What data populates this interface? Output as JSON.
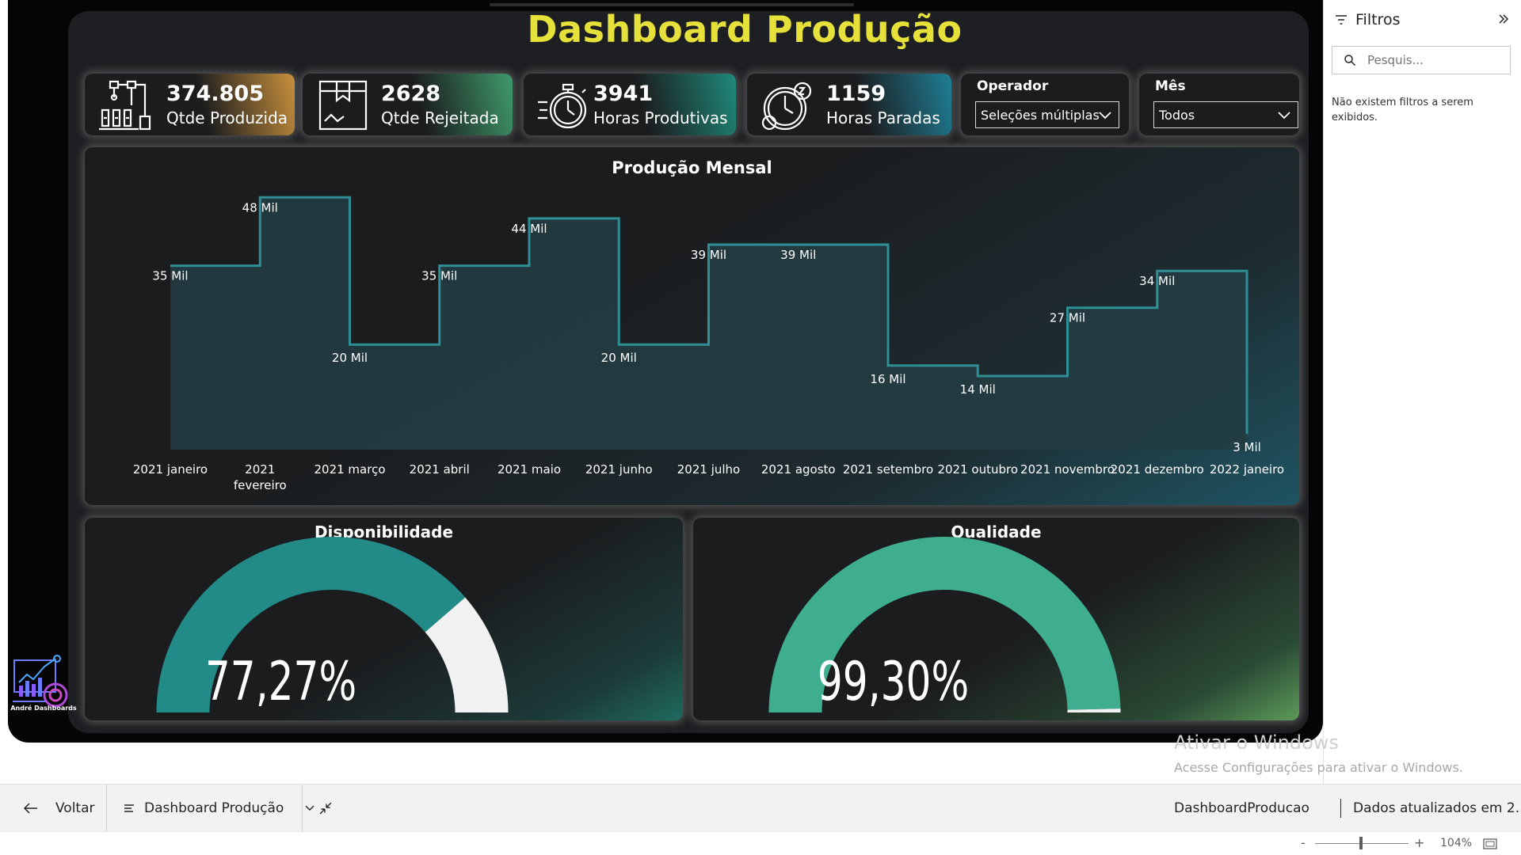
{
  "title": "Dashboard Produção",
  "kpis": [
    {
      "value": "374.805",
      "label": "Qtde Produzida",
      "icon": "robot-arm-factory-icon",
      "accent": "#e0a040"
    },
    {
      "value": "2628",
      "label": "Qtde Rejeitada",
      "icon": "rejected-box-icon",
      "accent": "#4fb07a"
    },
    {
      "value": "3941",
      "label": "Horas Produtivas",
      "icon": "stopwatch-icon",
      "accent": "#2aa08a"
    },
    {
      "value": "1159",
      "label": "Horas Paradas",
      "icon": "clock-sleep-icon",
      "accent": "#2a8aa0"
    }
  ],
  "slicers": {
    "operador": {
      "title": "Operador",
      "value": "Seleções múltiplas"
    },
    "mes": {
      "title": "Mês",
      "value": "Todos"
    }
  },
  "chart_data": {
    "type": "area",
    "title": "Produção Mensal",
    "step": true,
    "categories": [
      "2021 janeiro",
      "2021 fevereiro",
      "2021 março",
      "2021 abril",
      "2021 maio",
      "2021 junho",
      "2021 julho",
      "2021 agosto",
      "2021 setembro",
      "2021 outubro",
      "2021 novembro",
      "2021 dezembro",
      "2022 janeiro"
    ],
    "values": [
      35,
      48,
      20,
      35,
      44,
      20,
      39,
      39,
      16,
      14,
      27,
      34,
      3
    ],
    "data_labels": [
      "35 Mil",
      "48 Mil",
      "20 Mil",
      "35 Mil",
      "44 Mil",
      "20 Mil",
      "39 Mil",
      "39 Mil",
      "16 Mil",
      "14 Mil",
      "27 Mil",
      "34 Mil",
      "3 Mil"
    ],
    "unit": "Mil",
    "ylim": [
      0,
      50
    ],
    "line_color": "#2e8f96",
    "fill_color": "#243c42"
  },
  "gauges": [
    {
      "title": "Disponibilidade",
      "value": 0.7727,
      "display": "77,27%",
      "color": "#238b87",
      "rest_color": "#f2f2f2"
    },
    {
      "title": "Qualidade",
      "value": 0.993,
      "display": "99,30%",
      "color": "#3eae8e",
      "rest_color": "#f2f2f2"
    }
  ],
  "logo_text": "André Dashboards",
  "filters": {
    "title": "Filtros",
    "search_placeholder": "Pesquis...",
    "empty_message": "Não existem filtros a serem exibidos."
  },
  "watermark": {
    "title": "Ativar o Windows",
    "subtitle": "Acesse Configurações para ativar o Windows."
  },
  "bottom_bar": {
    "back_label": "Voltar",
    "page_label": "Dashboard Produção",
    "report_name": "DashboardProducao",
    "updated": "Dados atualizados em 2..."
  },
  "zoom": {
    "level": "104%",
    "minus": "-",
    "plus": "+"
  }
}
